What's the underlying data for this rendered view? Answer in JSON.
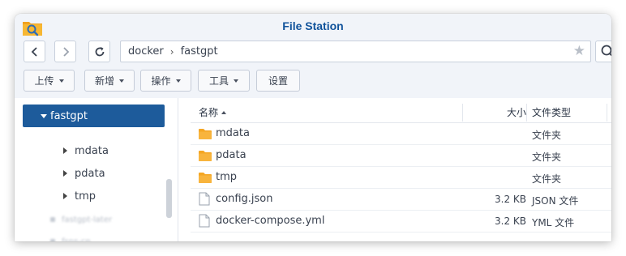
{
  "window": {
    "title": "File Station"
  },
  "path": {
    "segments": [
      "docker",
      "fastgpt"
    ]
  },
  "toolbar": {
    "upload_label": "上传",
    "create_label": "新增",
    "action_label": "操作",
    "tools_label": "工具",
    "settings_label": "设置"
  },
  "tree": {
    "selected": "fastgpt",
    "children": [
      "mdata",
      "pdata",
      "tmp"
    ],
    "blurred": [
      "fastgpt-later",
      "fsns-cp"
    ]
  },
  "list": {
    "headers": {
      "name": "名称",
      "size": "大小",
      "type": "文件类型"
    },
    "rows": [
      {
        "name": "mdata",
        "size": "",
        "type": "文件夹",
        "icon": "folder-icon"
      },
      {
        "name": "pdata",
        "size": "",
        "type": "文件夹",
        "icon": "folder-icon"
      },
      {
        "name": "tmp",
        "size": "",
        "type": "文件夹",
        "icon": "folder-icon"
      },
      {
        "name": "config.json",
        "size": "3.2 KB",
        "type": "JSON 文件",
        "icon": "file-icon"
      },
      {
        "name": "docker-compose.yml",
        "size": "3.2 KB",
        "type": "YML 文件",
        "icon": "file-icon"
      }
    ]
  },
  "colors": {
    "accent": "#1d5b9b",
    "title": "#11539b",
    "folder": "#f5a623"
  }
}
